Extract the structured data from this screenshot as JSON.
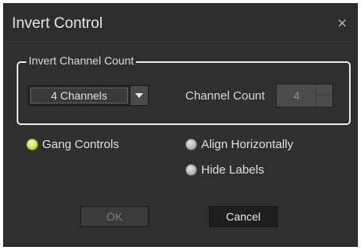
{
  "window": {
    "title": "Invert Control",
    "close_glyph": "×"
  },
  "group": {
    "legend": "Invert Channel Count",
    "channels_select": {
      "selected": "4 Channels",
      "arrow_icon": "triangle-down-icon"
    },
    "channel_count": {
      "label": "Channel Count",
      "value": "4",
      "enabled": false
    }
  },
  "options": {
    "gang_controls": {
      "label": "Gang Controls",
      "selected": true
    },
    "align_horizontally": {
      "label": "Align Horizontally",
      "selected": false
    },
    "hide_labels": {
      "label": "Hide Labels",
      "selected": false
    }
  },
  "buttons": {
    "ok": {
      "label": "OK",
      "enabled": false
    },
    "cancel": {
      "label": "Cancel",
      "enabled": true
    }
  },
  "colors": {
    "accent": "#c8e655",
    "background": "#2f2f2f"
  }
}
